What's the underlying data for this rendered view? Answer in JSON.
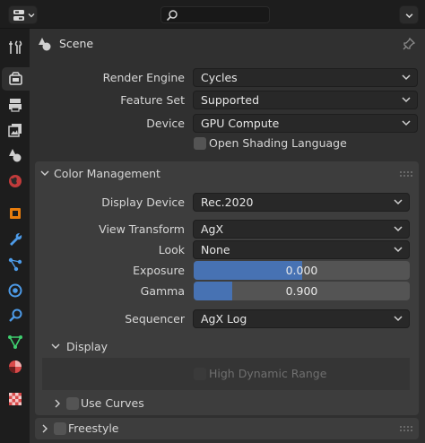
{
  "header": {
    "editor_icon": "properties-editor-icon",
    "search_icon": "search-icon",
    "search": {
      "value": "",
      "placeholder": ""
    }
  },
  "sidebar": {
    "tabs": [
      {
        "icon": "tool-icon",
        "active": false
      },
      {
        "icon": "render-icon",
        "active": true
      },
      {
        "icon": "output-icon",
        "active": false
      },
      {
        "icon": "view-layer-icon",
        "active": false
      },
      {
        "icon": "scene-icon",
        "active": false
      },
      {
        "icon": "world-icon",
        "active": false
      },
      {
        "icon": "object-icon",
        "active": false
      },
      {
        "icon": "modifier-icon",
        "active": false
      },
      {
        "icon": "particles-icon",
        "active": false
      },
      {
        "icon": "physics-icon",
        "active": false
      },
      {
        "icon": "constraints-icon",
        "active": false
      },
      {
        "icon": "object-data-icon",
        "active": false
      },
      {
        "icon": "material-icon",
        "active": false
      },
      {
        "icon": "texture-icon",
        "active": false
      }
    ]
  },
  "context": {
    "title": "Scene",
    "pin_icon": "pin-icon"
  },
  "render": {
    "engine": {
      "label": "Render Engine",
      "value": "Cycles"
    },
    "feature_set": {
      "label": "Feature Set",
      "value": "Supported"
    },
    "device": {
      "label": "Device",
      "value": "GPU Compute"
    },
    "osl": {
      "label": "Open Shading Language",
      "checked": false
    }
  },
  "color_management": {
    "title": "Color Management",
    "display_device": {
      "label": "Display Device",
      "value": "Rec.2020"
    },
    "view_transform": {
      "label": "View Transform",
      "value": "AgX"
    },
    "look": {
      "label": "Look",
      "value": "None"
    },
    "exposure": {
      "label": "Exposure",
      "value": "0.000",
      "fill_fraction": 0.5
    },
    "gamma": {
      "label": "Gamma",
      "value": "0.900",
      "fill_fraction": 0.18
    },
    "sequencer": {
      "label": "Sequencer",
      "value": "AgX Log"
    },
    "display": {
      "title": "Display",
      "hdr": {
        "label": "High Dynamic Range",
        "checked": false,
        "enabled": false
      }
    },
    "use_curves": {
      "label": "Use Curves",
      "checked": false
    }
  },
  "freestyle": {
    "label": "Freestyle",
    "checked": false
  },
  "colors": {
    "accent": "#4772b3",
    "panel": "#303030",
    "background": "#1d1d1d"
  }
}
